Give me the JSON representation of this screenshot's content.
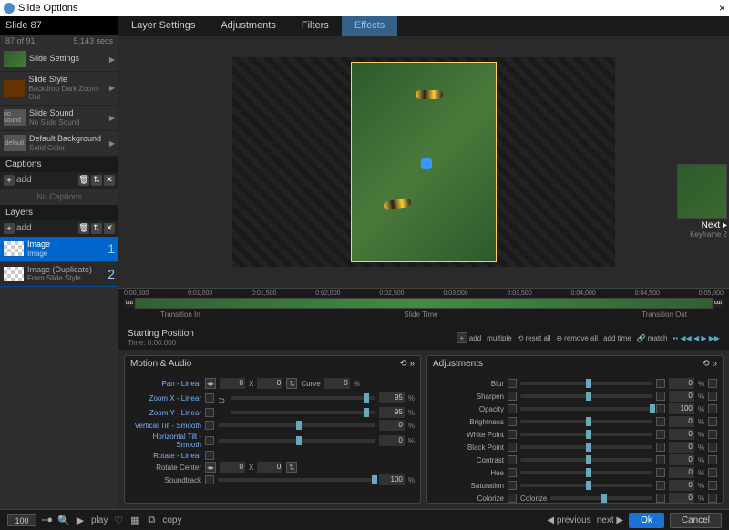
{
  "window": {
    "title": "Slide Options",
    "close": "×"
  },
  "slide": {
    "name": "Slide 87",
    "count": "87 of 91",
    "duration": "5.143 secs"
  },
  "sidebar": {
    "settings": [
      {
        "label": "Slide Settings",
        "sub": ""
      },
      {
        "label": "Slide Style",
        "sub": "Backdrop Dark Zoom Out"
      },
      {
        "label": "Slide Sound",
        "sub": "No Slide Sound",
        "thumb": "no sound"
      },
      {
        "label": "Default Background",
        "sub": "Solid Color",
        "thumb": "default"
      }
    ],
    "captions": {
      "header": "Captions",
      "add": "add",
      "empty": "No Captions"
    },
    "layers": {
      "header": "Layers",
      "add": "add",
      "items": [
        {
          "title": "Image",
          "sub": "Image",
          "num": "1"
        },
        {
          "title": "Image (Duplicate)",
          "sub": "From Slide Style",
          "num": "2"
        }
      ]
    }
  },
  "tabs": [
    "Layer Settings",
    "Adjustments",
    "Filters",
    "Effects"
  ],
  "next": {
    "label": "Next",
    "sub": "Keyframe 2"
  },
  "timeline": {
    "ticks": [
      "0:00,500",
      "0:01,000",
      "0:01,500",
      "0:02,000",
      "0:02,500",
      "0:03,000",
      "0:03,500",
      "0:04,000",
      "0:04,500",
      "0:05,000"
    ],
    "cut": "cut",
    "labels": {
      "in": "Transition In",
      "mid": "Slide Time",
      "out": "Transition Out"
    },
    "starting": "Starting Position",
    "time": "Time: 0:00.000",
    "tools": {
      "add": "add",
      "multiple": "multiple",
      "resetall": "reset all",
      "removeall": "remove all",
      "addtime": "add time",
      "match": "match"
    }
  },
  "motion": {
    "header": "Motion & Audio",
    "rows": [
      {
        "label": "Pan - Linear",
        "v1": "0",
        "x": "X",
        "v2": "0",
        "curve": "Curve",
        "cv": "0"
      },
      {
        "label": "Zoom X - Linear",
        "v": "95"
      },
      {
        "label": "Zoom Y - Linear",
        "v": "95"
      },
      {
        "label": "Vertical Tilt - Smooth",
        "v": "0"
      },
      {
        "label": "Horizontal Tilt - Smooth",
        "v": "0"
      },
      {
        "label": "Rotate - Linear"
      },
      {
        "label": "Rotate Center",
        "v1": "0",
        "x": "X",
        "v2": "0"
      },
      {
        "label": "Soundtrack",
        "v": "100"
      }
    ]
  },
  "adjustments": {
    "header": "Adjustments",
    "rows": [
      {
        "label": "Blur",
        "v": "0"
      },
      {
        "label": "Sharpen",
        "v": "0"
      },
      {
        "label": "Opacity",
        "v": "100"
      },
      {
        "label": "Brightness",
        "v": "0"
      },
      {
        "label": "White Point",
        "v": "0"
      },
      {
        "label": "Black Point",
        "v": "0"
      },
      {
        "label": "Contrast",
        "v": "0"
      },
      {
        "label": "Hue",
        "v": "0"
      },
      {
        "label": "Saturation",
        "v": "0"
      },
      {
        "label": "Colorize",
        "sub": "Colorize",
        "v": "0"
      }
    ]
  },
  "footer": {
    "zoom": "100",
    "play": "play",
    "copy": "copy",
    "previous": "previous",
    "next": "next",
    "ok": "Ok",
    "cancel": "Cancel"
  },
  "pct": "%"
}
